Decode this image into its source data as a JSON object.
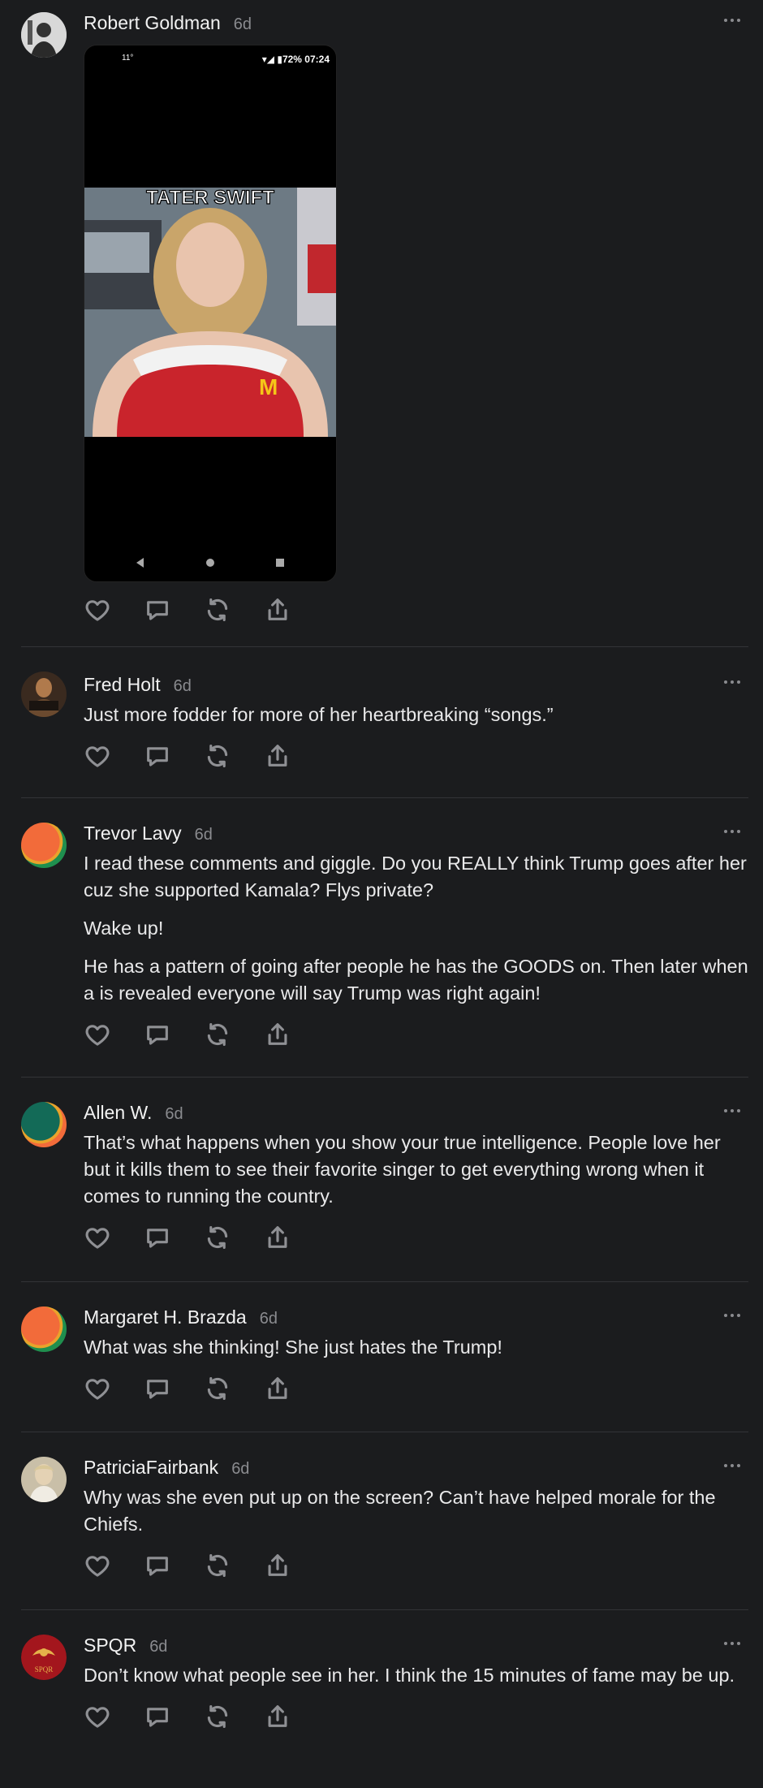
{
  "posts": [
    {
      "author": "Robert Goldman",
      "time": "6d",
      "screenshot": {
        "status_right": "▾◢ ▮72% 07:24",
        "status_left": "11°",
        "meme_caption": "TATER SWIFT"
      },
      "paragraphs": []
    },
    {
      "author": "Fred Holt",
      "time": "6d",
      "paragraphs": [
        "Just more fodder for more of her heartbreaking “songs.”"
      ]
    },
    {
      "author": "Trevor Lavy",
      "time": "6d",
      "paragraphs": [
        "I read these comments and giggle. Do you REALLY think Trump goes after her cuz she supported Kamala? Flys private?",
        "Wake up!",
        "He has a pattern of going after people he has the GOODS on. Then later when a is revealed everyone will say Trump was right again!"
      ]
    },
    {
      "author": "Allen W.",
      "time": "6d",
      "paragraphs": [
        "That’s what happens when you show your true intelligence. People love her but it kills them to see their favorite singer to get everything wrong when it comes to running the country."
      ]
    },
    {
      "author": "Margaret H. Brazda",
      "time": "6d",
      "paragraphs": [
        "What was she thinking! She just hates the Trump!"
      ]
    },
    {
      "author": "PatriciaFairbank",
      "time": "6d",
      "paragraphs": [
        "Why was she even put up on the screen? Can’t have helped morale for the Chiefs."
      ]
    },
    {
      "author": "SPQR",
      "time": "6d",
      "paragraphs": [
        "Don’t know what people see in her. I think the 15 minutes of fame may be up."
      ]
    }
  ],
  "icons": [
    "heart-icon",
    "comment-icon",
    "repost-icon",
    "share-icon",
    "more-icon"
  ],
  "colors": {
    "background": "#1b1c1e",
    "muted": "#8a8b8f",
    "text": "#ececec",
    "divider": "#333437"
  }
}
